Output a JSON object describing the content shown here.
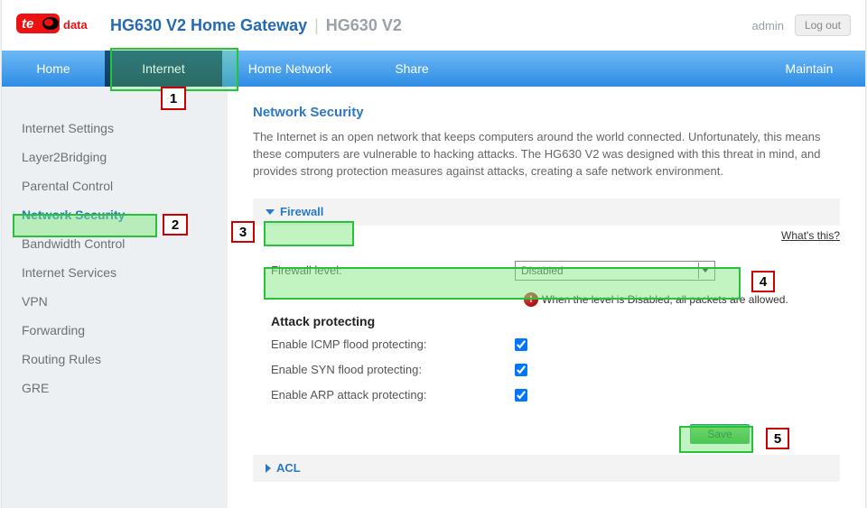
{
  "header": {
    "title_main": "HG630 V2 Home Gateway",
    "title_sub": "HG630 V2",
    "user": "admin",
    "logout": "Log out"
  },
  "nav": {
    "home": "Home",
    "internet": "Internet",
    "home_network": "Home Network",
    "share": "Share",
    "maintain": "Maintain"
  },
  "sidebar": {
    "items": [
      "Internet Settings",
      "Layer2Bridging",
      "Parental Control",
      "Network Security",
      "Bandwidth Control",
      "Internet Services",
      "VPN",
      "Forwarding",
      "Routing Rules",
      "GRE"
    ],
    "active_index": 3
  },
  "main": {
    "heading": "Network Security",
    "intro": "The Internet is an open network that keeps computers around the world connected. Unfortunately, this means these computers are vulnerable to hacking attacks. The HG630 V2 was designed with this threat in mind, and provides strong protection measures against attacks, creating a safe network environment.",
    "section_firewall": "Firewall",
    "whats_this": "What's this?",
    "firewall_level_label": "Firewall level:",
    "firewall_level_value": "Disabled",
    "warn_text": "When the level is Disabled, all packets are allowed.",
    "subhead_attack": "Attack protecting",
    "opt_icmp": "Enable ICMP flood protecting:",
    "opt_syn": "Enable SYN flood protecting:",
    "opt_arp": "Enable ARP attack protecting:",
    "save": "Save",
    "section_acl": "ACL"
  },
  "callouts": {
    "c1": "1",
    "c2": "2",
    "c3": "3",
    "c4": "4",
    "c5": "5"
  }
}
